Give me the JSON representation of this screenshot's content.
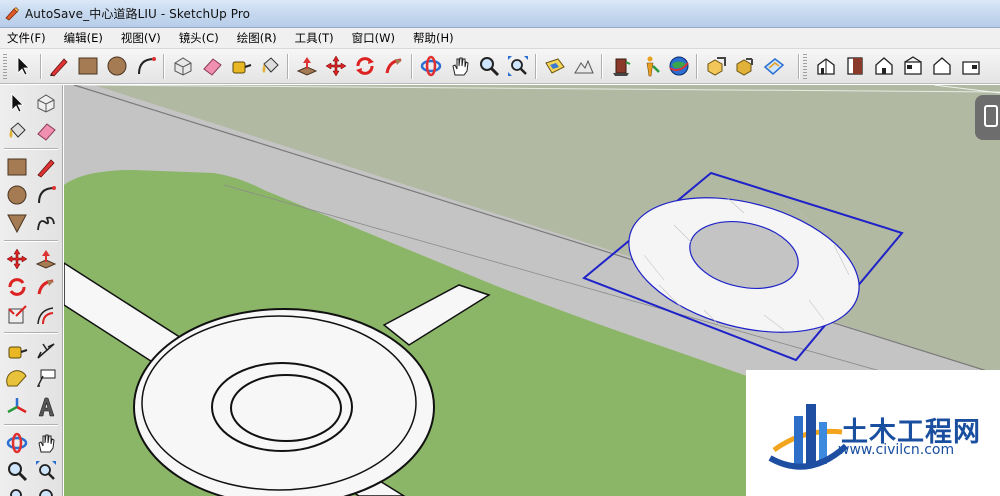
{
  "window": {
    "title": "AutoSave_中心道路LIU - SketchUp Pro"
  },
  "menu": [
    "文件(F)",
    "编辑(E)",
    "视图(V)",
    "镜头(C)",
    "绘图(R)",
    "工具(T)",
    "窗口(W)",
    "帮助(H)"
  ],
  "toolbar": {
    "tools": [
      "select",
      "line",
      "rectangle",
      "circle",
      "arc",
      "make-component",
      "eraser",
      "tape-measure",
      "paint-bucket",
      "push-pull",
      "move",
      "rotate",
      "follow-me",
      "orbit",
      "pan",
      "zoom",
      "zoom-extents",
      "add-location",
      "toggle-terrain",
      "preview-model",
      "get-models",
      "share-model",
      "share-component",
      "get-photo-texture",
      "iso-view",
      "top-view",
      "front-view",
      "right-view",
      "back-view",
      "left-view"
    ]
  },
  "left_toolbar": {
    "tools": [
      "select",
      "make-component",
      "paint-bucket",
      "eraser",
      "rectangle",
      "line",
      "circle",
      "arc",
      "polygon",
      "freehand",
      "move",
      "push-pull",
      "rotate",
      "follow-me",
      "scale",
      "offset",
      "tape-measure",
      "dimension",
      "protractor",
      "text",
      "axes",
      "3d-text",
      "orbit",
      "pan",
      "zoom",
      "zoom-window",
      "zoom-extents",
      "previous"
    ]
  },
  "colors": {
    "grass": "#8cb667",
    "road": "#c4c4c4",
    "sky_ground": "#b2b9a2",
    "selection": "#1e22c8",
    "paving": "#f7f7f7"
  },
  "watermark": {
    "title": "土木工程网",
    "url": "www.civilcn.com"
  }
}
